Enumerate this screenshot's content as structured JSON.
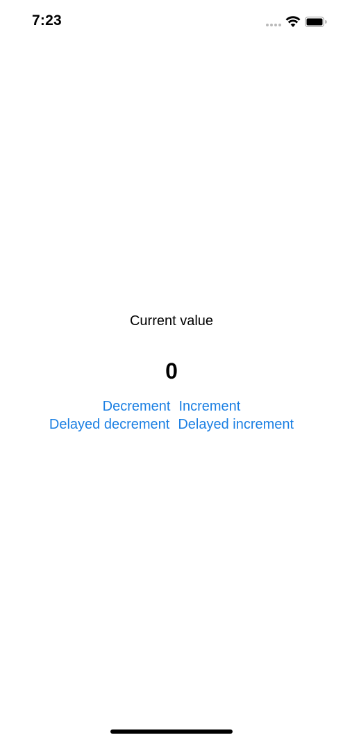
{
  "status_bar": {
    "time": "7:23",
    "icons": [
      "signal-icon",
      "wifi-icon",
      "battery-icon"
    ]
  },
  "main": {
    "label": "Current value",
    "value": "0",
    "buttons": {
      "decrement": "Decrement",
      "increment": "Increment",
      "delayed_decrement": "Delayed decrement",
      "delayed_increment": "Delayed increment"
    }
  },
  "colors": {
    "accent": "#1a7fe3",
    "text": "#000000",
    "background": "#ffffff"
  }
}
